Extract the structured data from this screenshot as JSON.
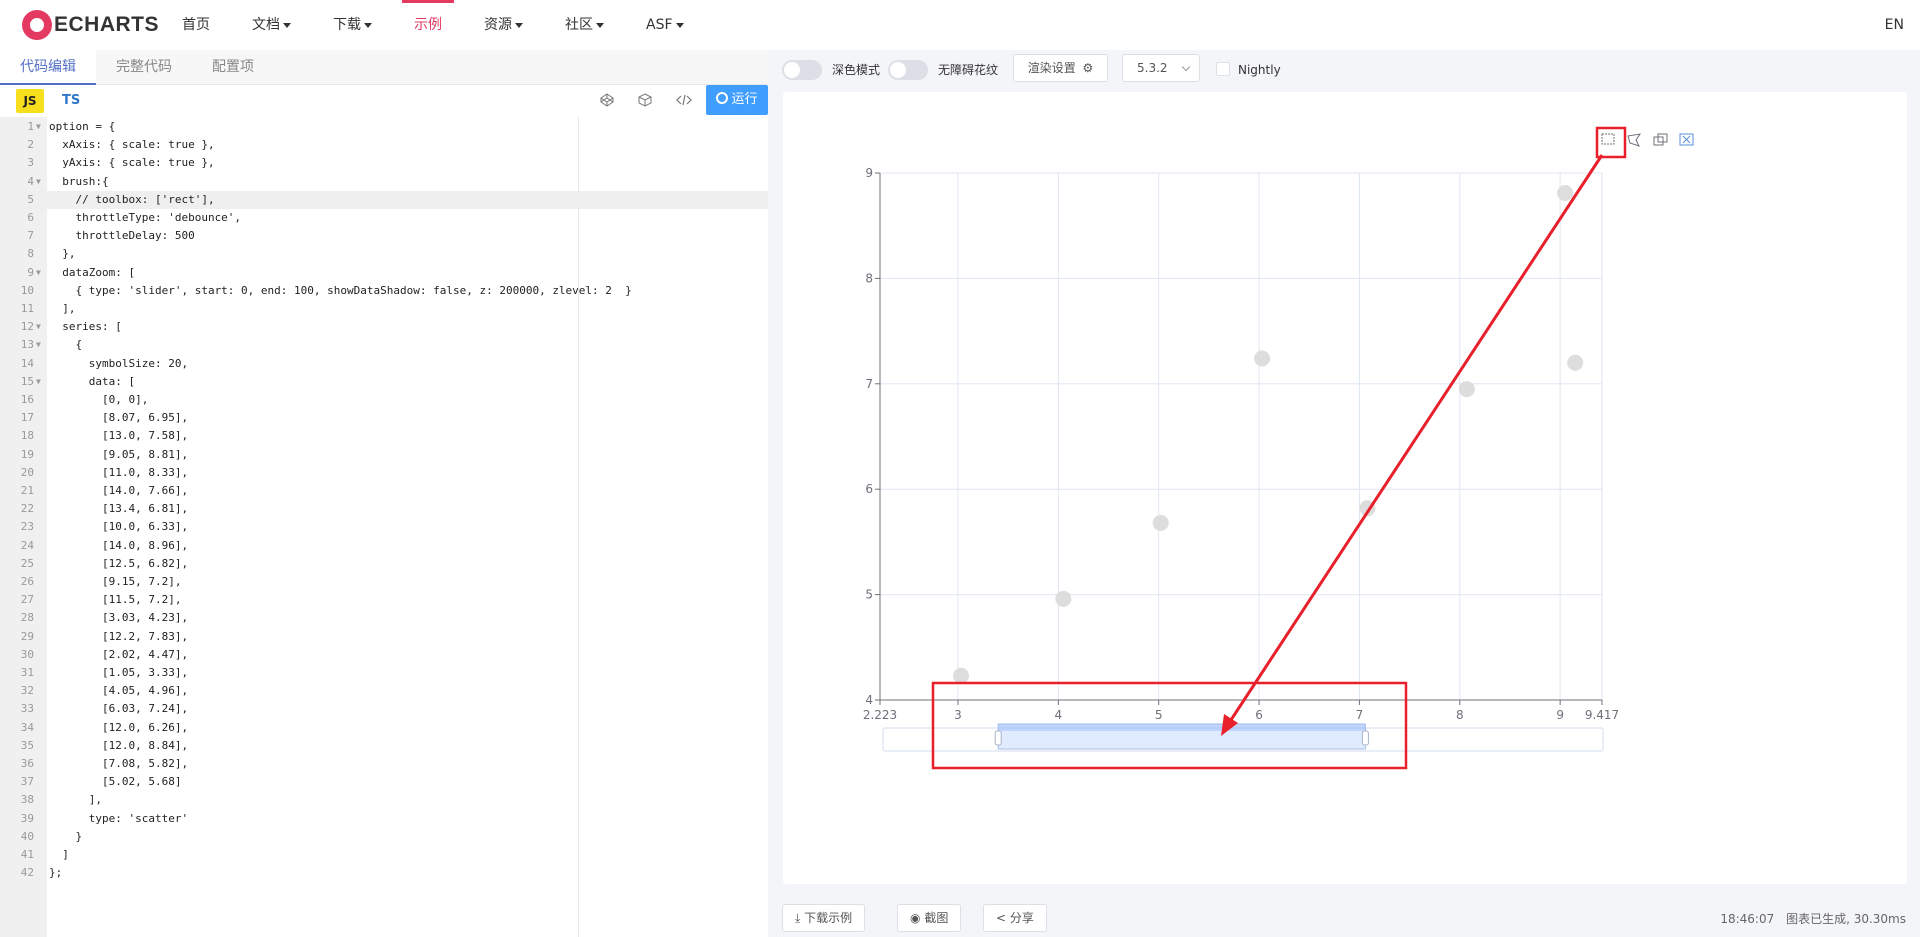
{
  "nav": {
    "logo_text": "ECHARTS",
    "items": [
      {
        "label": "首页",
        "dropdown": false,
        "active": false
      },
      {
        "label": "文档",
        "dropdown": true,
        "active": false
      },
      {
        "label": "下载",
        "dropdown": true,
        "active": false
      },
      {
        "label": "示例",
        "dropdown": false,
        "active": true
      },
      {
        "label": "资源",
        "dropdown": true,
        "active": false
      },
      {
        "label": "社区",
        "dropdown": true,
        "active": false
      },
      {
        "label": "ASF",
        "dropdown": true,
        "active": false
      }
    ],
    "lang": "EN",
    "accent": "#e43961"
  },
  "editor": {
    "tabs": [
      "代码编辑",
      "完整代码",
      "配置项"
    ],
    "active_tab": "代码编辑",
    "lang_js": "JS",
    "lang_ts": "TS",
    "run_label": "运行",
    "current_line": 5,
    "lines": [
      "option = {",
      "  xAxis: { scale: true },",
      "  yAxis: { scale: true },",
      "  brush:{",
      "    // toolbox: ['rect'],",
      "    throttleType: 'debounce',",
      "    throttleDelay: 500",
      "  },",
      "  dataZoom: [",
      "    { type: 'slider', start: 0, end: 100, showDataShadow: false, z: 200000, zlevel: 2  }",
      "  ],",
      "  series: [",
      "    {",
      "      symbolSize: 20,",
      "      data: [",
      "        [0, 0],",
      "        [8.07, 6.95],",
      "        [13.0, 7.58],",
      "        [9.05, 8.81],",
      "        [11.0, 8.33],",
      "        [14.0, 7.66],",
      "        [13.4, 6.81],",
      "        [10.0, 6.33],",
      "        [14.0, 8.96],",
      "        [12.5, 6.82],",
      "        [9.15, 7.2],",
      "        [11.5, 7.2],",
      "        [3.03, 4.23],",
      "        [12.2, 7.83],",
      "        [2.02, 4.47],",
      "        [1.05, 3.33],",
      "        [4.05, 4.96],",
      "        [6.03, 7.24],",
      "        [12.0, 6.26],",
      "        [12.0, 8.84],",
      "        [7.08, 5.82],",
      "        [5.02, 5.68]",
      "      ],",
      "      type: 'scatter'",
      "    }",
      "  ]",
      "};"
    ],
    "fold_lines": [
      1,
      4,
      9,
      12,
      13,
      15
    ]
  },
  "preview": {
    "dark_mode_label": "深色模式",
    "aria_label": "无障碍花纹",
    "render_settings_label": "渲染设置",
    "version": "5.3.2",
    "nightly_label": "Nightly",
    "download_label": "下载示例",
    "screenshot_label": "截图",
    "share_label": "分享",
    "time": "18:46:07",
    "status_text": "图表已生成, 30.30ms",
    "toolbox_icons": [
      "brush-rect-icon",
      "brush-polygon-icon",
      "brush-keep-icon",
      "brush-clear-icon"
    ]
  },
  "chart_data": {
    "type": "scatter",
    "xlim": [
      2.223,
      9.417
    ],
    "ylim": [
      4,
      9
    ],
    "x_tick_labels": [
      "2.223",
      "3",
      "4",
      "5",
      "6",
      "7",
      "8",
      "9",
      "9.417"
    ],
    "y_tick_labels": [
      "4",
      "5",
      "6",
      "7",
      "8",
      "9"
    ],
    "series": [
      {
        "points": [
          [
            8.07,
            6.95
          ],
          [
            9.05,
            8.81
          ],
          [
            9.15,
            7.2
          ],
          [
            3.03,
            4.23
          ],
          [
            4.05,
            4.96
          ],
          [
            6.03,
            7.24
          ],
          [
            7.08,
            5.82
          ],
          [
            5.02,
            5.68
          ]
        ]
      }
    ],
    "symbol_color": "#d9d9d9",
    "grid": true,
    "datazoom": {
      "start": 0.16,
      "end": 0.67
    },
    "annotation_color": "#e8202c"
  }
}
